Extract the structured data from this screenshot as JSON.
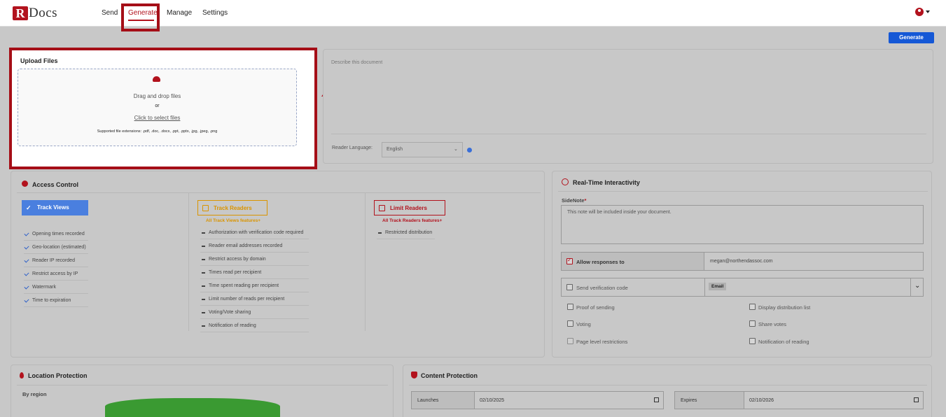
{
  "header": {
    "logo_r": "R",
    "logo_rest": "Docs",
    "nav": [
      "Send",
      "Generate",
      "Manage",
      "Settings"
    ]
  },
  "generate_button": "Generate",
  "upload": {
    "title": "Upload Files",
    "drag": "Drag and drop files",
    "or": "or",
    "click": "Click to select files",
    "supported": "Supported file extensions: .pdf, .doc, .docx, .ppt, .pptx, .jpg, .jpeg, .png"
  },
  "describe": {
    "placeholder": "Describe this document",
    "reader_language_label": "Reader Language:",
    "reader_language_value": "English"
  },
  "access": {
    "title": "Access Control",
    "track_views": {
      "label": "Track Views",
      "items": [
        "Opening times recorded",
        "Geo-location (estimated)",
        "Reader IP recorded",
        "Restrict access by IP",
        "Watermark",
        "Time to expiration"
      ]
    },
    "track_readers": {
      "label": "Track Readers",
      "sub": "All Track Views features+",
      "items": [
        "Authorization with verification code required",
        "Reader email addresses recorded",
        "Restrict access by domain",
        "Times read per recipient",
        "Time spent reading per recipient",
        "Limit number of reads per recipient",
        "Voting/Vote sharing",
        "Notification of reading"
      ]
    },
    "limit_readers": {
      "label": "Limit Readers",
      "sub": "All Track Readers features+",
      "items": [
        "Restricted distribution"
      ]
    }
  },
  "rti": {
    "title": "Real-Time Interactivity",
    "sidenote_label": "SideNote",
    "sidenote_required": "*",
    "sidenote_placeholder": "This note will be included inside your document.",
    "allow_responses": "Allow responses to",
    "allow_email": "megan@northendassoc.com",
    "send_verification": "Send verification code",
    "verification_method": "Email",
    "options_left": [
      "Proof of sending",
      "Voting",
      "Page level restrictions"
    ],
    "options_right": [
      "Display distribution list",
      "Share votes",
      "Notification of reading"
    ]
  },
  "location": {
    "title": "Location Protection",
    "by_region": "By region"
  },
  "content": {
    "title": "Content Protection",
    "launches_label": "Launches",
    "launches_value": "02/10/2025",
    "expires_label": "Expires",
    "expires_value": "02/10/2026"
  },
  "colors": {
    "brand": "#b2121d",
    "primary": "#1558d6",
    "highlight": "#a50e17"
  }
}
